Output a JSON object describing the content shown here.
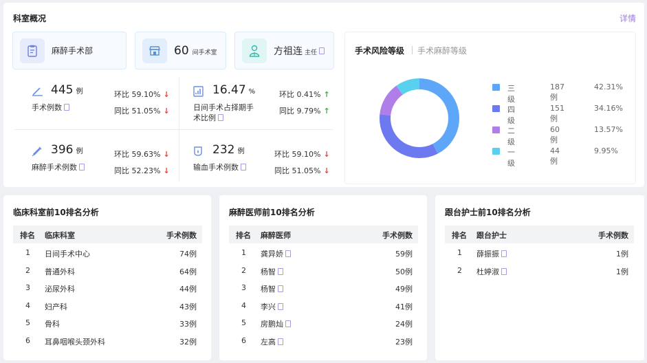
{
  "overview": {
    "title": "科室概况",
    "detail_link": "详情",
    "info_boxes": {
      "dept": {
        "name": "麻醉手术部"
      },
      "rooms": {
        "count": "60",
        "unit": "间手术室"
      },
      "director": {
        "name": "方祖连",
        "role": "主任"
      }
    },
    "metrics": [
      {
        "value": "445",
        "unit": "例",
        "label": "手术例数",
        "hb_label": "环比",
        "hb_value": "59.10%",
        "hb_dir": "down",
        "tb_label": "同比",
        "tb_value": "51.05%",
        "tb_dir": "down"
      },
      {
        "value": "16.47",
        "unit": "%",
        "label_line1": "日间手术占择期手",
        "label_line2": "术比例",
        "hb_label": "环比",
        "hb_value": "0.41%",
        "hb_dir": "up",
        "tb_label": "同比",
        "tb_value": "9.79%",
        "tb_dir": "up"
      },
      {
        "value": "396",
        "unit": "例",
        "label": "麻醉手术例数",
        "hb_label": "环比",
        "hb_value": "59.63%",
        "hb_dir": "down",
        "tb_label": "同比",
        "tb_value": "52.23%",
        "tb_dir": "down"
      },
      {
        "value": "232",
        "unit": "例",
        "label": "输血手术例数",
        "hb_label": "环比",
        "hb_value": "59.10%",
        "hb_dir": "down",
        "tb_label": "同比",
        "tb_value": "51.05%",
        "tb_dir": "down"
      }
    ],
    "arrows": {
      "down": "↓",
      "up": "↑"
    }
  },
  "risk": {
    "tab_active": "手术风险等级",
    "tab_inactive": "手术麻醉等级",
    "legend": [
      {
        "name": "三级",
        "count": "187例",
        "pct": "42.31%",
        "color": "#5ea6f8"
      },
      {
        "name": "四级",
        "count": "151例",
        "pct": "34.16%",
        "color": "#6c79ef"
      },
      {
        "name": "二级",
        "count": "60例",
        "pct": "13.57%",
        "color": "#b07ee9"
      },
      {
        "name": "一级",
        "count": "44例",
        "pct": "9.95%",
        "color": "#58d0ee"
      }
    ]
  },
  "chart_data": {
    "type": "pie",
    "categories": [
      "三级",
      "四级",
      "二级",
      "一级"
    ],
    "values": [
      187,
      151,
      60,
      44
    ],
    "percent": [
      42.31,
      34.16,
      13.57,
      9.95
    ],
    "colors": [
      "#5ea6f8",
      "#6c79ef",
      "#b07ee9",
      "#58d0ee"
    ]
  },
  "tables": {
    "clinical": {
      "title": "临床科室前10排名分析",
      "headers": [
        "排名",
        "临床科室",
        "手术例数"
      ],
      "rows": [
        {
          "rank": "1",
          "name": "日间手术中心",
          "count": "74例"
        },
        {
          "rank": "2",
          "name": "普通外科",
          "count": "64例"
        },
        {
          "rank": "3",
          "name": "泌尿外科",
          "count": "44例"
        },
        {
          "rank": "4",
          "name": "妇产科",
          "count": "43例"
        },
        {
          "rank": "5",
          "name": "骨科",
          "count": "33例"
        },
        {
          "rank": "6",
          "name": "耳鼻咽喉头颈外科",
          "count": "32例"
        }
      ]
    },
    "anesthetist": {
      "title": "麻醉医师前10排名分析",
      "headers": [
        "排名",
        "麻醉医师",
        "手术例数"
      ],
      "rows": [
        {
          "rank": "1",
          "name": "龚异娇",
          "count": "59例"
        },
        {
          "rank": "2",
          "name": "杨智",
          "count": "50例"
        },
        {
          "rank": "3",
          "name": "杨智",
          "count": "49例"
        },
        {
          "rank": "4",
          "name": "李兴",
          "count": "41例"
        },
        {
          "rank": "5",
          "name": "房鹏灿",
          "count": "24例"
        },
        {
          "rank": "6",
          "name": "左高",
          "count": "23例"
        }
      ]
    },
    "nurse": {
      "title": "跟台护士前10排名分析",
      "headers": [
        "排名",
        "跟台护士",
        "手术例数"
      ],
      "rows": [
        {
          "rank": "1",
          "name": "薛振振",
          "count": "1例"
        },
        {
          "rank": "2",
          "name": "杜婷淑",
          "count": "1例"
        }
      ]
    }
  }
}
